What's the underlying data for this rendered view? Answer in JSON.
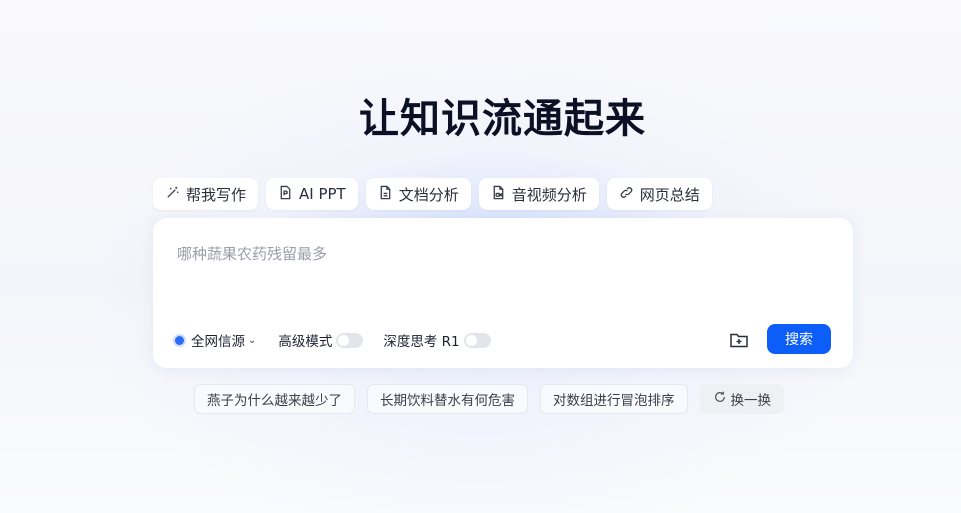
{
  "hero": {
    "title": "让知识流通起来"
  },
  "tools": [
    {
      "label": "帮我写作",
      "icon": "magic-wand-icon"
    },
    {
      "label": "AI PPT",
      "icon": "ppt-file-icon"
    },
    {
      "label": "文档分析",
      "icon": "document-icon"
    },
    {
      "label": "音视频分析",
      "icon": "audio-video-file-icon"
    },
    {
      "label": "网页总结",
      "icon": "link-icon"
    }
  ],
  "search": {
    "placeholder": "哪种蔬果农药残留最多",
    "value": "",
    "source_label": "全网信源",
    "advanced_label": "高级模式",
    "advanced_on": false,
    "deep_label": "深度思考 R1",
    "deep_on": false,
    "submit_label": "搜索"
  },
  "suggestions": [
    "燕子为什么越来越少了",
    "长期饮料替水有何危害",
    "对数组进行冒泡排序"
  ],
  "refresh_label": "换一换",
  "colors": {
    "accent": "#0d5ef8",
    "title": "#0b1024"
  }
}
